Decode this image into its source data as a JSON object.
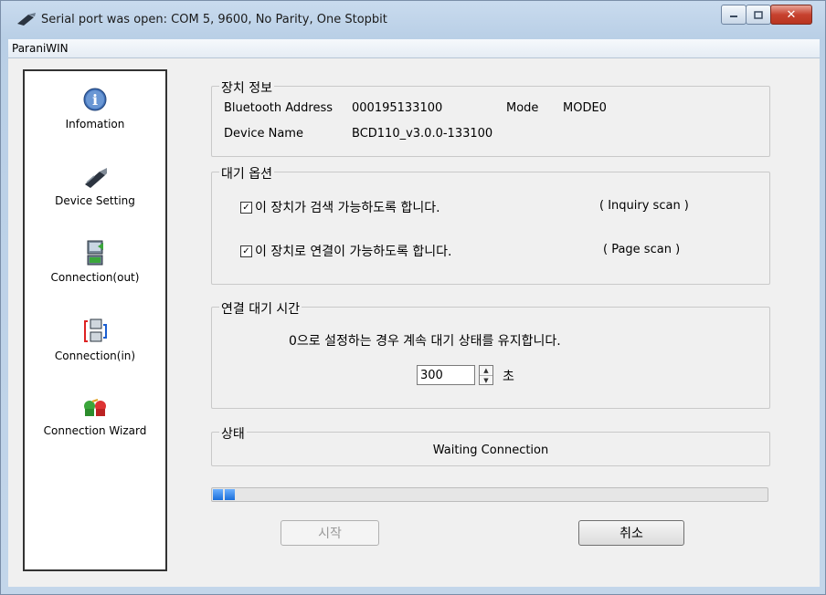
{
  "window": {
    "title": "Serial port was open: COM 5, 9600, No Parity, One Stopbit",
    "menu": "ParaniWIN"
  },
  "sidebar": {
    "items": [
      {
        "label": "Infomation",
        "icon": "info-icon"
      },
      {
        "label": "Device Setting",
        "icon": "device-icon"
      },
      {
        "label": "Connection(out)",
        "icon": "connection-out-icon"
      },
      {
        "label": "Connection(in)",
        "icon": "connection-in-icon"
      },
      {
        "label": "Connection Wizard",
        "icon": "wizard-icon"
      }
    ]
  },
  "device_info": {
    "title": "장치 정보",
    "bt_address_label": "Bluetooth Address",
    "bt_address_value": "000195133100",
    "mode_label": "Mode",
    "mode_value": "MODE0",
    "device_name_label": "Device Name",
    "device_name_value": "BCD110_v3.0.0-133100"
  },
  "standby_options": {
    "title": "대기 옵션",
    "inquiry_label": "이 장치가 검색 가능하도록 합니다.",
    "inquiry_hint": "( Inquiry scan )",
    "inquiry_checked": true,
    "page_label": "이 장치로 연결이 가능하도록 합니다.",
    "page_hint": "( Page scan )",
    "page_checked": true,
    "check_mark": "✓"
  },
  "wait_time": {
    "title": "연결 대기 시간",
    "description": "0으로 설정하는 경우 계속 대기 상태를 유지합니다.",
    "value": "300",
    "unit": "초"
  },
  "status": {
    "title": "상태",
    "text": "Waiting Connection"
  },
  "progress": {
    "percent": 4,
    "color": "#1b6fd9"
  },
  "buttons": {
    "start": "시작",
    "cancel": "취소"
  },
  "colors": {
    "close_button": "#c7422f",
    "title_gradient": "#c9dbee"
  }
}
